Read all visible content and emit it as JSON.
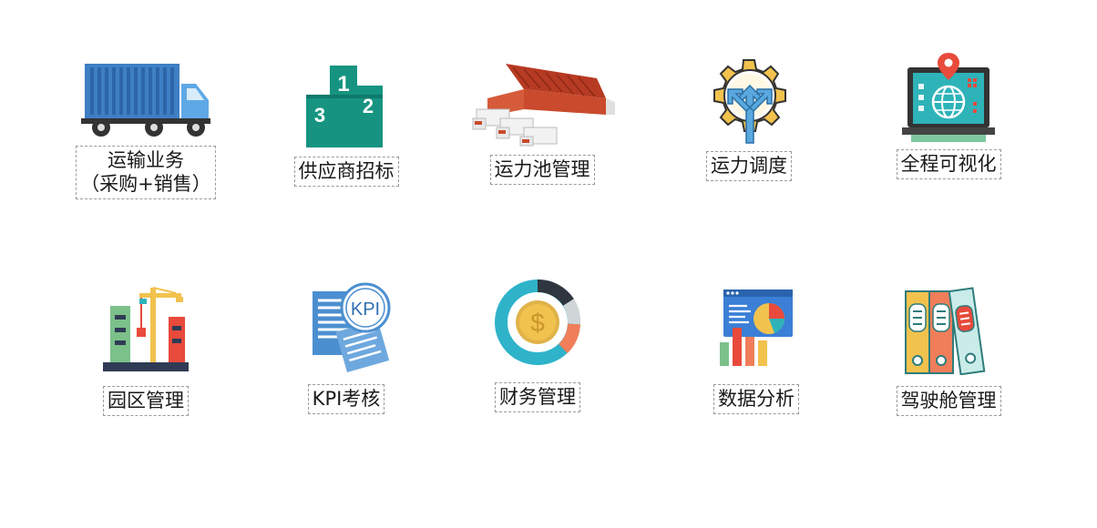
{
  "modules": [
    {
      "label_line1": "运输业务",
      "label_line2": "（采购+销售）",
      "icon": "truck-icon"
    },
    {
      "label": "供应商招标",
      "icon": "podium-icon"
    },
    {
      "label": "运力池管理",
      "icon": "warehouse-trucks-icon"
    },
    {
      "label": "运力调度",
      "icon": "gear-arrows-icon"
    },
    {
      "label": "全程可视化",
      "icon": "laptop-globe-icon"
    },
    {
      "label": "园区管理",
      "icon": "construction-park-icon"
    },
    {
      "label": "KPI考核",
      "icon": "kpi-document-icon"
    },
    {
      "label": "财务管理",
      "icon": "finance-dollar-icon"
    },
    {
      "label": "数据分析",
      "icon": "data-analysis-icon"
    },
    {
      "label": "驾驶舱管理",
      "icon": "binders-icon"
    }
  ]
}
